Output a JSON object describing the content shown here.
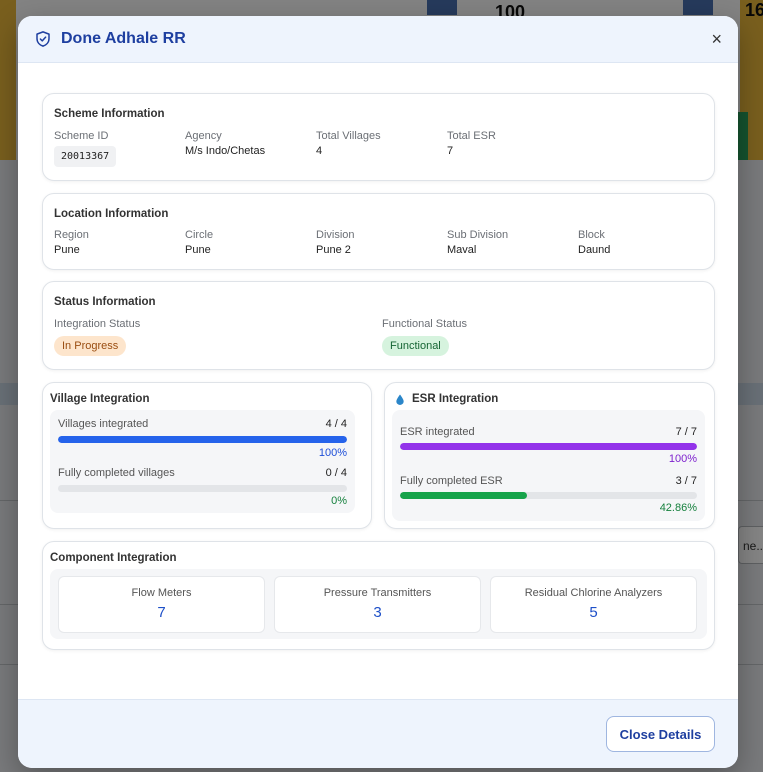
{
  "modal": {
    "title": "Done Adhale RR",
    "close_icon": "×"
  },
  "scheme_info": {
    "title": "Scheme Information",
    "fields": [
      {
        "label": "Scheme ID",
        "value": "20013367"
      },
      {
        "label": "Agency",
        "value": "M/s Indo/Chetas"
      },
      {
        "label": "Total Villages",
        "value": "4"
      },
      {
        "label": "Total ESR",
        "value": "7"
      }
    ]
  },
  "location_info": {
    "title": "Location Information",
    "fields": [
      {
        "label": "Region",
        "value": "Pune"
      },
      {
        "label": "Circle",
        "value": "Pune"
      },
      {
        "label": "Division",
        "value": "Pune 2"
      },
      {
        "label": "Sub Division",
        "value": "Maval"
      },
      {
        "label": "Block",
        "value": "Daund"
      }
    ]
  },
  "status_info": {
    "title": "Status Information",
    "integration_label": "Integration Status",
    "integration_value": "In Progress",
    "integration_color": "#fde5cc",
    "functional_label": "Functional Status",
    "functional_value": "Functional",
    "functional_color": "#d6f3de"
  },
  "village_integration": {
    "title": "Village Integration",
    "rows": [
      {
        "label": "Villages integrated",
        "count": "4 / 4",
        "percent": "100%",
        "fraction": 1.0,
        "color": "#2563eb",
        "pct_color": "#1d4ed8"
      },
      {
        "label": "Fully completed villages",
        "count": "0 / 4",
        "percent": "0%",
        "fraction": 0.0,
        "color": "#16a34a",
        "pct_color": "#15803d"
      }
    ]
  },
  "esr_integration": {
    "title": "ESR Integration",
    "icon": "water-drop-icon",
    "rows": [
      {
        "label": "ESR integrated",
        "count": "7 / 7",
        "percent": "100%",
        "fraction": 1.0,
        "color": "#9333ea",
        "pct_color": "#7e22ce"
      },
      {
        "label": "Fully completed ESR",
        "count": "3 / 7",
        "percent": "42.86%",
        "fraction": 0.4286,
        "color": "#16a34a",
        "pct_color": "#15803d"
      }
    ]
  },
  "component_integration": {
    "title": "Component Integration",
    "items": [
      {
        "label": "Flow Meters",
        "value": "7"
      },
      {
        "label": "Pressure Transmitters",
        "value": "3"
      },
      {
        "label": "Residual Chlorine Analyzers",
        "value": "5"
      }
    ]
  },
  "footer": {
    "close_label": "Close Details"
  },
  "background": {
    "num1": "100",
    "num2": "16",
    "select_text": "ne..."
  }
}
